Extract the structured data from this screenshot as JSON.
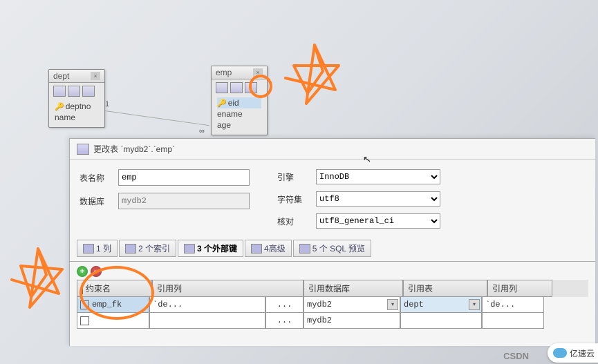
{
  "diagram": {
    "dept": {
      "title": "dept",
      "fields": [
        "deptno",
        "name"
      ]
    },
    "emp": {
      "title": "emp",
      "fields": [
        "eid",
        "ename",
        "age"
      ],
      "keyField": "eid"
    },
    "cardinality": {
      "one": "1",
      "many": "∞"
    }
  },
  "dialog": {
    "title": "更改表 `mydb2`.`emp`",
    "form": {
      "tableNameLabel": "表名称",
      "tableName": "emp",
      "dbLabel": "数据库",
      "db": "mydb2",
      "engineLabel": "引擎",
      "engine": "InnoDB",
      "charsetLabel": "字符集",
      "charset": "utf8",
      "collationLabel": "核对",
      "collation": "utf8_general_ci"
    },
    "tabs": {
      "cols": "1 列",
      "idx": "2 个索引",
      "fk": "3 个外部键",
      "adv": "4高级",
      "sql": "5 个 SQL 预览"
    },
    "grid": {
      "headers": {
        "constraint": "约束名",
        "refCol": "引用列",
        "refDb": "引用数据库",
        "refTable": "引用表",
        "refCol2": "引用列"
      },
      "rows": [
        {
          "constraint": "emp_fk",
          "refCol": "`de...",
          "refColBtn": "...",
          "refDb": "mydb2",
          "refTable": "dept",
          "refCol2": "`de..."
        },
        {
          "constraint": "",
          "refCol": "",
          "refColBtn": "...",
          "refDb": "mydb2",
          "refTable": "",
          "refCol2": ""
        }
      ]
    }
  },
  "watermarks": {
    "csdn": "CSDN",
    "yisu": "亿速云"
  }
}
